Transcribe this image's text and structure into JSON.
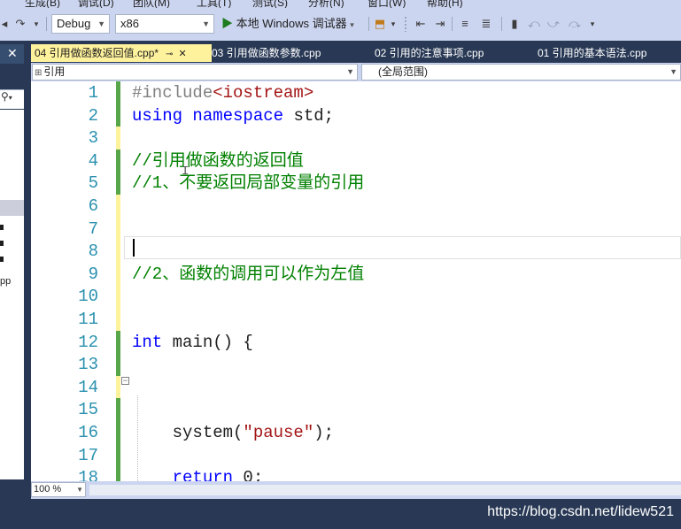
{
  "menu": {
    "items": [
      "生成(B)",
      "调试(D)",
      "团队(M)",
      "工具(T)",
      "测试(S)",
      "分析(N)",
      "窗口(W)",
      "帮助(H)"
    ]
  },
  "toolbar": {
    "config": "Debug",
    "platform": "x86",
    "run_label": "本地 Windows 调试器"
  },
  "tabs": [
    {
      "label": "04 引用做函数返回值.cpp*",
      "active": true
    },
    {
      "label": "03 引用做函数参数.cpp",
      "active": false
    },
    {
      "label": "02 引用的注意事项.cpp",
      "active": false
    },
    {
      "label": "01 引用的基本语法.cpp",
      "active": false
    }
  ],
  "navbar": {
    "scope_left": "引用",
    "scope_right": "(全局范围)"
  },
  "left_panel": {
    "fragment": "pp"
  },
  "code": {
    "lines": [
      {
        "n": "1",
        "parts": [
          {
            "c": "pp",
            "t": "#include"
          },
          {
            "c": "st",
            "t": "<iostream>"
          }
        ]
      },
      {
        "n": "2",
        "parts": [
          {
            "c": "kw",
            "t": "using"
          },
          {
            "c": "tx",
            "t": " "
          },
          {
            "c": "kw",
            "t": "namespace"
          },
          {
            "c": "tx",
            "t": " std;"
          }
        ]
      },
      {
        "n": "3",
        "parts": []
      },
      {
        "n": "4",
        "parts": [
          {
            "c": "cm",
            "t": "//引用做函数的返回值"
          }
        ]
      },
      {
        "n": "5",
        "parts": [
          {
            "c": "cm",
            "t": "//1、不要返回局部变量的引用"
          }
        ]
      },
      {
        "n": "6",
        "parts": []
      },
      {
        "n": "7",
        "parts": []
      },
      {
        "n": "8",
        "parts": []
      },
      {
        "n": "9",
        "parts": [
          {
            "c": "cm",
            "t": "//2、函数的调用可以作为左值"
          }
        ]
      },
      {
        "n": "10",
        "parts": []
      },
      {
        "n": "11",
        "parts": []
      },
      {
        "n": "12",
        "parts": [
          {
            "c": "kw",
            "t": "int"
          },
          {
            "c": "tx",
            "t": " main() {"
          }
        ]
      },
      {
        "n": "13",
        "parts": []
      },
      {
        "n": "14",
        "parts": []
      },
      {
        "n": "15",
        "parts": []
      },
      {
        "n": "16",
        "parts": [
          {
            "c": "tx",
            "t": "    system("
          },
          {
            "c": "st",
            "t": "\"pause\""
          },
          {
            "c": "tx",
            "t": ");"
          }
        ]
      },
      {
        "n": "17",
        "parts": []
      },
      {
        "n": "18",
        "parts": [
          {
            "c": "tx",
            "t": "    "
          },
          {
            "c": "kw",
            "t": "return"
          },
          {
            "c": "tx",
            "t": " 0;"
          }
        ]
      }
    ],
    "change_marks": [
      "saved",
      "saved",
      "unsaved",
      "saved",
      "saved",
      "unsaved",
      "unsaved",
      "unsaved",
      "unsaved",
      "unsaved",
      "unsaved",
      "saved",
      "saved",
      "unsaved",
      "saved",
      "saved",
      "saved",
      "saved"
    ]
  },
  "status": {
    "zoom": "100 %"
  },
  "watermark": "https://blog.csdn.net/lidew521",
  "colors": {
    "keyword": "#0000FF",
    "comment": "#008000",
    "string": "#A31515",
    "line_number": "#2B91AF",
    "saved_change": "#57A64A",
    "unsaved_change": "#FFF29D",
    "active_tab": "#FFF29D",
    "chrome": "#293955"
  }
}
